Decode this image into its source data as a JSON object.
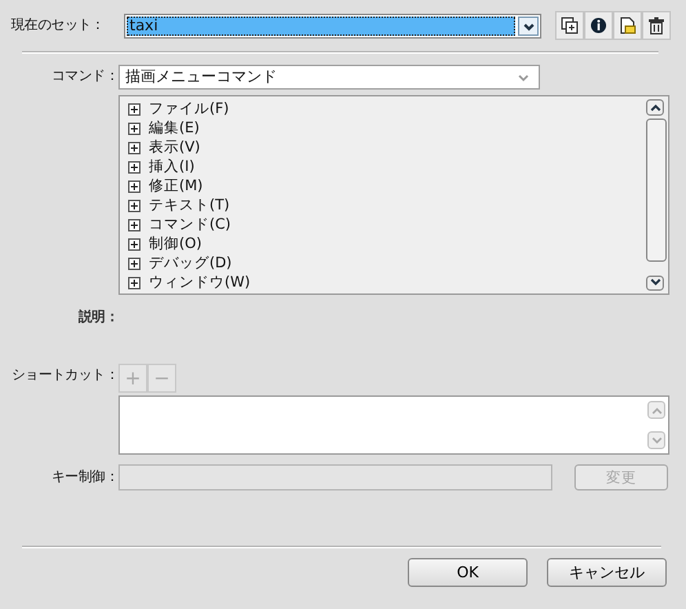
{
  "current_set": {
    "label": "現在のセット：",
    "value": "taxi",
    "selected": true
  },
  "set_tools": [
    {
      "kind": "duplicate"
    },
    {
      "kind": "info"
    },
    {
      "kind": "export"
    },
    {
      "kind": "delete"
    }
  ],
  "command": {
    "label": "コマンド：",
    "value": "描画メニューコマンド"
  },
  "tree": [
    {
      "label": "ファイル(F)",
      "expanded": false
    },
    {
      "label": "編集(E)",
      "expanded": false
    },
    {
      "label": "表示(V)",
      "expanded": false
    },
    {
      "label": "挿入(I)",
      "expanded": false
    },
    {
      "label": "修正(M)",
      "expanded": false
    },
    {
      "label": "テキスト(T)",
      "expanded": false
    },
    {
      "label": "コマンド(C)",
      "expanded": false
    },
    {
      "label": "制御(O)",
      "expanded": false
    },
    {
      "label": "デバッグ(D)",
      "expanded": false
    },
    {
      "label": "ウィンドウ(W)",
      "expanded": false
    }
  ],
  "description": {
    "label": "説明："
  },
  "shortcut": {
    "label": "ショートカット：",
    "add": "+",
    "remove": "−",
    "disabled": true
  },
  "key_control": {
    "label": "キー制御：",
    "change_button": "変更",
    "disabled": true
  },
  "buttons": [
    "OK",
    "キャンセル"
  ]
}
